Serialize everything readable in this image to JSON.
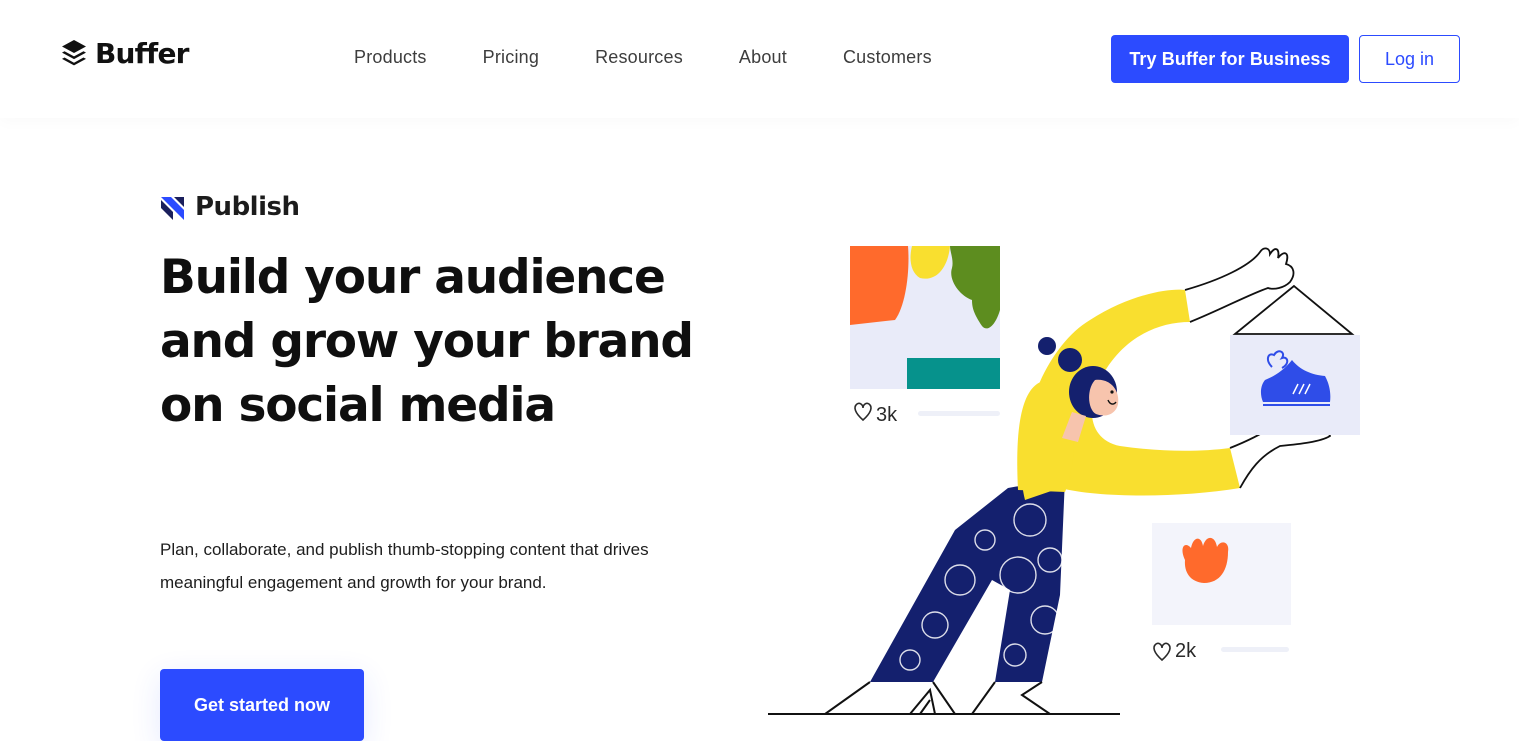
{
  "brand": {
    "name": "Buffer",
    "accent_color": "#2c4bff"
  },
  "nav": {
    "items": [
      {
        "label": "Products"
      },
      {
        "label": "Pricing"
      },
      {
        "label": "Resources"
      },
      {
        "label": "About"
      },
      {
        "label": "Customers"
      }
    ]
  },
  "header": {
    "business_button_label": "Try Buffer for Business",
    "login_button_label": "Log in"
  },
  "hero": {
    "product_name": "Publish",
    "product_icon": "publish-arrow-icon",
    "headline": "Build your audience and grow your brand on social media",
    "subtext": "Plan, collaborate, and publish thumb-stopping content that drives meaningful engagement and growth for your brand.",
    "cta_label": "Get started now"
  },
  "illustration": {
    "post_one_likes": "3k",
    "post_two_likes": "2k",
    "colors": {
      "yellow": "#f9df2f",
      "navy": "#14206e",
      "orange": "#ff6a2c",
      "green": "#5d8d1f",
      "teal": "#06928c",
      "lavender": "#e9ebf9",
      "skin": "#f7c4ad",
      "shoe_blue": "#2f4de8"
    }
  }
}
